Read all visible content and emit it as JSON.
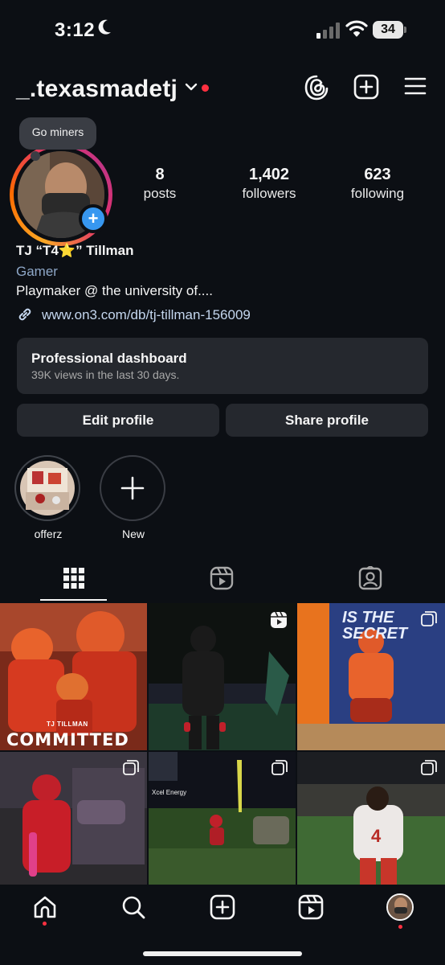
{
  "status_bar": {
    "time": "3:12",
    "battery": "34"
  },
  "header": {
    "username": "_.texasmadetj"
  },
  "note": {
    "text": "Go miners"
  },
  "stats": [
    {
      "value": "8",
      "label": "posts"
    },
    {
      "value": "1,402",
      "label": "followers"
    },
    {
      "value": "623",
      "label": "following"
    }
  ],
  "bio": {
    "name": "TJ “T4⭐️” Tillman",
    "category": "Gamer",
    "text": "Playmaker @ the university of....",
    "link": "www.on3.com/db/tj-tillman-156009"
  },
  "dashboard": {
    "title": "Professional dashboard",
    "subtitle": "39K views in the last 30 days."
  },
  "buttons": {
    "edit": "Edit profile",
    "share": "Share profile"
  },
  "highlights": [
    {
      "label": "offerz"
    },
    {
      "label": "New"
    }
  ],
  "posts": [
    {
      "overlay_top": "TJ TILLMAN",
      "overlay_main": "COMMITTED",
      "type": "image"
    },
    {
      "type": "reel"
    },
    {
      "banner": "IS THE SECRET",
      "type": "image"
    },
    {
      "type": "carousel"
    },
    {
      "type": "carousel",
      "ad_text": "Xcel Energy"
    },
    {
      "jersey": "4",
      "type": "carousel"
    }
  ],
  "colors": {
    "background": "#0c0f14",
    "card": "#25282e",
    "accent": "#3797f0",
    "notification": "#ff3040",
    "link": "#c4d6ee"
  }
}
